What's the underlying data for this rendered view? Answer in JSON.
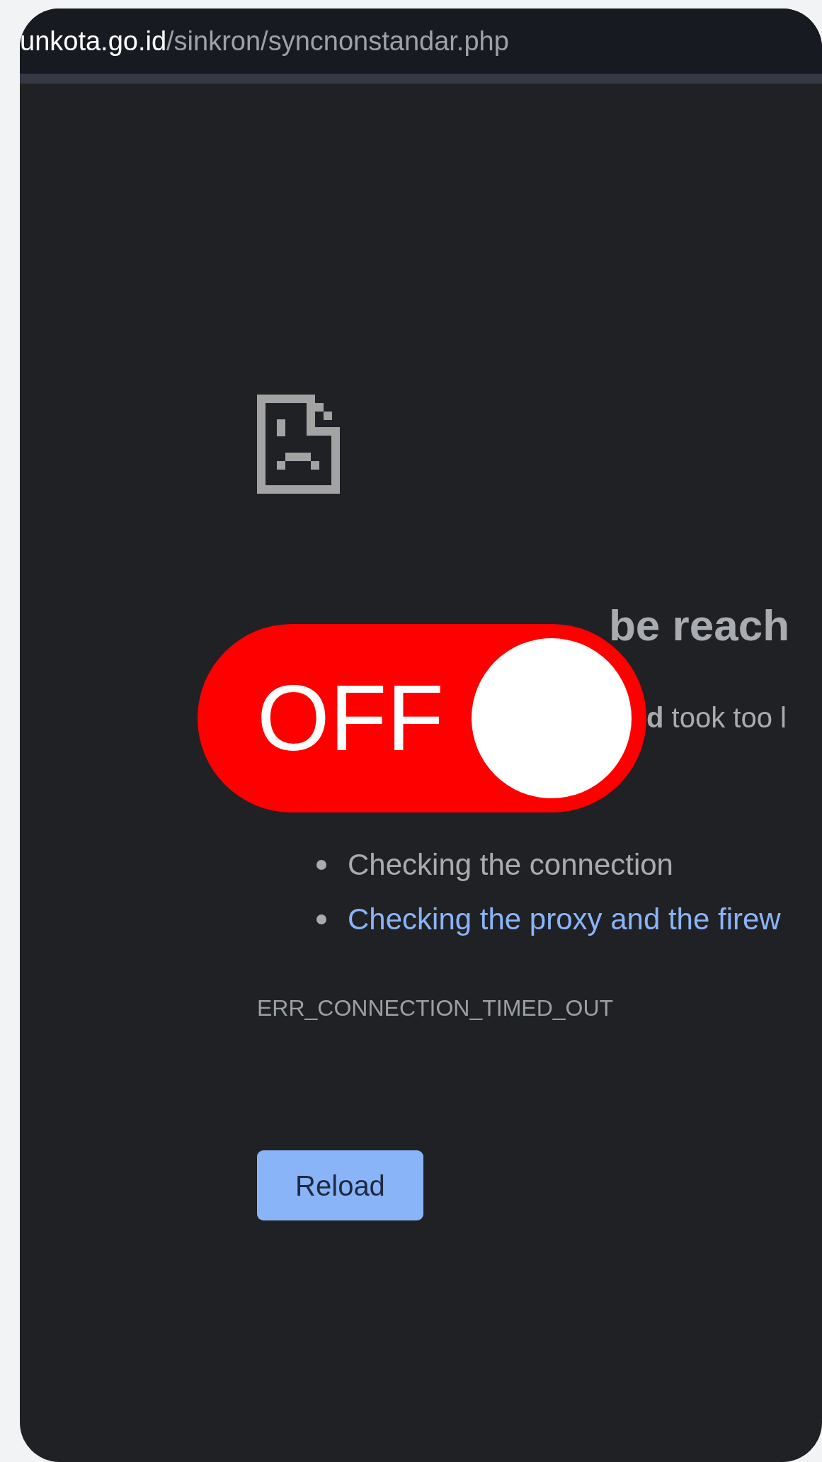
{
  "address_bar": {
    "host": "unkota.go.id",
    "path": "/sinkron/syncnonstandar.php"
  },
  "error_page": {
    "heading": "be reach",
    "message": "**d** took too l",
    "suggestions": [
      {
        "kind": "text",
        "text": "Checking the connection"
      },
      {
        "kind": "link",
        "text": "Checking the proxy and the firew"
      }
    ],
    "error_code": "ERR_CONNECTION_TIMED_OUT",
    "reload_button": "Reload"
  },
  "toggle": {
    "label": "OFF",
    "on": false
  }
}
